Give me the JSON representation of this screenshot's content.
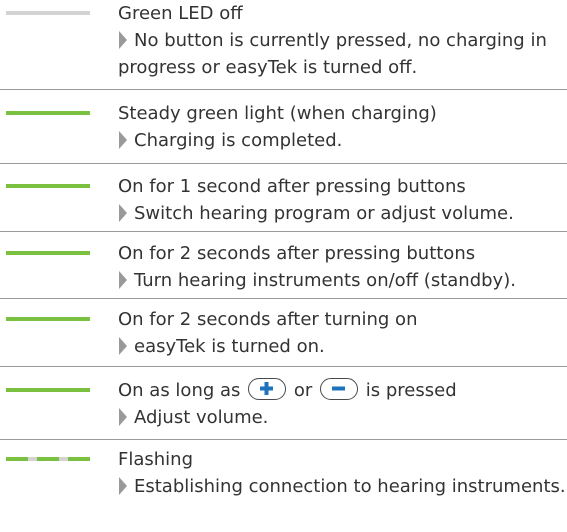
{
  "rows": [
    {
      "led": "off",
      "title": "Green LED off",
      "desc": "No button is currently pressed, no charging in progress or easyTek is turned off."
    },
    {
      "led": "steady",
      "title": "Steady green light (when charging)",
      "desc": "Charging is completed."
    },
    {
      "led": "steady",
      "title": "On for 1 second after pressing buttons",
      "desc": "Switch hearing program or adjust volume."
    },
    {
      "led": "steady",
      "title": "On for 2 seconds after pressing buttons",
      "desc": "Turn hearing instruments on/off (standby)."
    },
    {
      "led": "steady",
      "title": "On for 2 seconds after turning on",
      "desc": "easyTek is turned on."
    },
    {
      "led": "steady",
      "title_pre": "On as long as",
      "title_mid": "or",
      "title_post": "is pressed",
      "desc": "Adjust volume."
    },
    {
      "led": "flashing",
      "title": "Flashing",
      "desc": "Establishing connection to hearing instruments."
    }
  ],
  "colors": {
    "led_on": "#7ac142",
    "led_off": "#d3d3d3",
    "plus_minus": "#1e73be",
    "arrow": "#999999"
  },
  "icons": {
    "plus": "plus-button-icon",
    "minus": "minus-button-icon",
    "arrow": "arrow-bullet-icon"
  }
}
